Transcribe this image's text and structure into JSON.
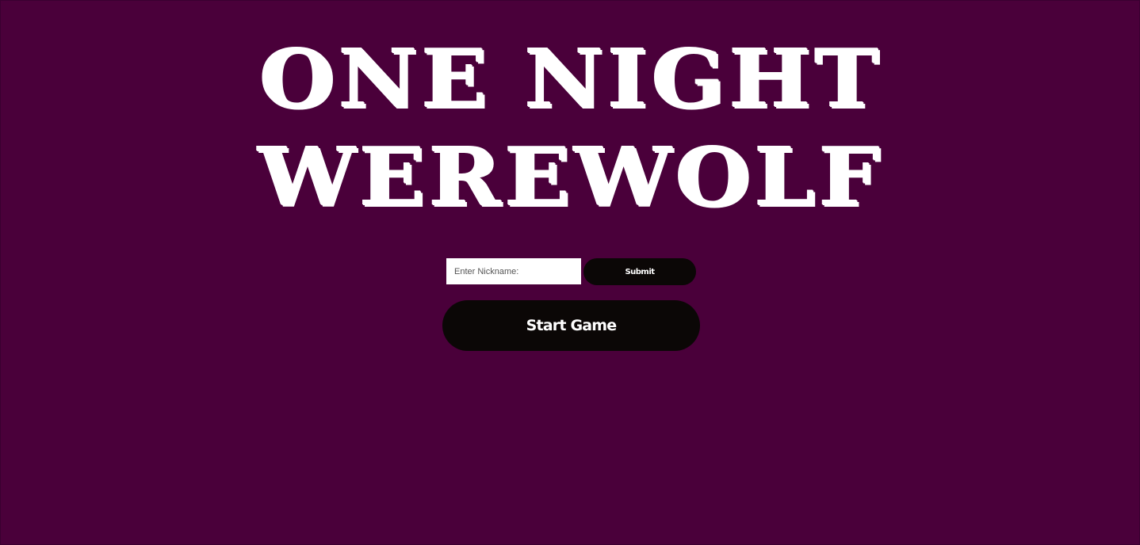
{
  "title": {
    "line1": "ONE NIGHT",
    "line2": "WEREWOLF"
  },
  "nickname_form": {
    "placeholder": "Enter Nickname:",
    "value": "",
    "submit_label": "Submit"
  },
  "start_button": {
    "label": "Start Game"
  },
  "colors": {
    "background": "#4a003a",
    "button": "#0b0706",
    "text": "#ffffff"
  }
}
